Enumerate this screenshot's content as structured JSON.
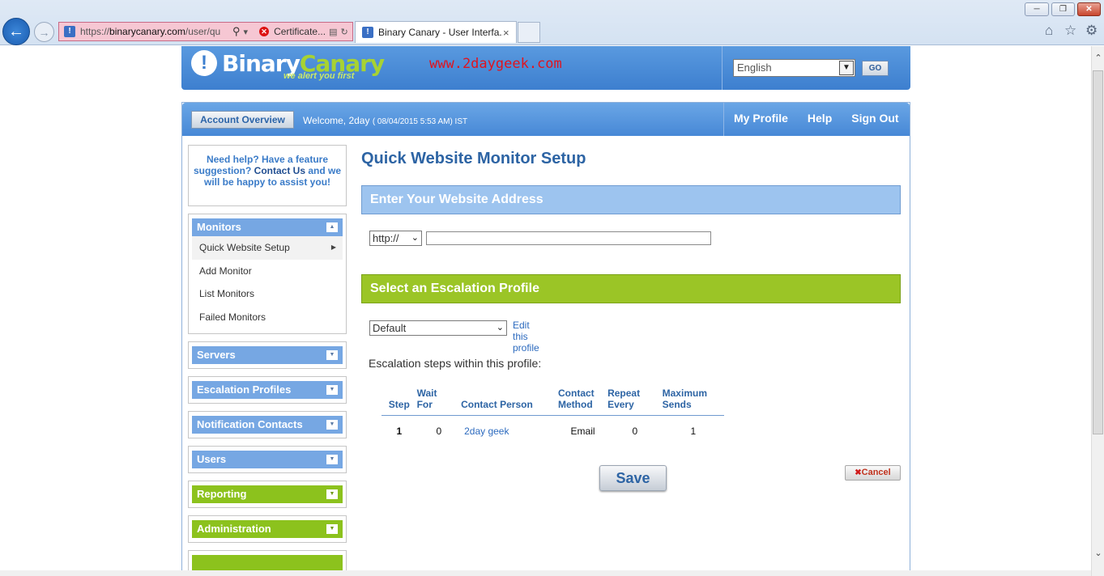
{
  "browser": {
    "url_prefix": "https://",
    "url_domain": "binarycanary.com",
    "url_path": "/user/qu",
    "cert_label": "Certificate...",
    "tab_title": "Binary Canary - User Interfa...",
    "tab_close": "×"
  },
  "header": {
    "logo_binary": "Binary",
    "logo_canary": "Canary",
    "tagline": "we alert you first",
    "watermark": "www.2daygeek.com",
    "language": "English",
    "go_label": "GO"
  },
  "topbar": {
    "account_overview": "Account Overview",
    "welcome": "Welcome, 2day",
    "timestamp": "( 08/04/2015 5:53 AM) IST",
    "nav": [
      "My Profile",
      "Help",
      "Sign Out"
    ]
  },
  "sidebar": {
    "help_text_1": "Need help? Have a feature suggestion?",
    "help_contact": "Contact Us",
    "help_text_2": "and we will be happy to assist you!",
    "monitors": {
      "title": "Monitors",
      "items": [
        "Quick Website Setup",
        "Add Monitor",
        "List Monitors",
        "Failed Monitors"
      ]
    },
    "groups": [
      {
        "title": "Servers",
        "color": "blue"
      },
      {
        "title": "Escalation Profiles",
        "color": "blue"
      },
      {
        "title": "Notification Contacts",
        "color": "blue"
      },
      {
        "title": "Users",
        "color": "blue"
      },
      {
        "title": "Reporting",
        "color": "green"
      },
      {
        "title": "Administration",
        "color": "green"
      }
    ]
  },
  "content": {
    "page_title": "Quick Website Monitor Setup",
    "website_section": "Enter Your Website Address",
    "protocol": "http://",
    "url_value": "",
    "escalation_section": "Select an Escalation Profile",
    "profile": "Default",
    "edit_profile": "Edit this profile",
    "steps_label": "Escalation steps within this profile:",
    "table": {
      "headers": {
        "step": "Step",
        "wait_1": "Wait",
        "wait_2": "For",
        "person": "Contact Person",
        "method_1": "Contact",
        "method_2": "Method",
        "repeat_1": "Repeat",
        "repeat_2": "Every",
        "max_1": "Maximum",
        "max_2": "Sends"
      },
      "rows": [
        {
          "step": "1",
          "wait": "0",
          "person": "2day geek",
          "method": "Email",
          "repeat": "0",
          "max": "1"
        }
      ]
    },
    "save_label": "Save",
    "cancel_label": "Cancel"
  },
  "colors": {
    "brand_blue": "#4788d6",
    "brand_green": "#8cc21d",
    "link_blue": "#2d6bbf"
  }
}
